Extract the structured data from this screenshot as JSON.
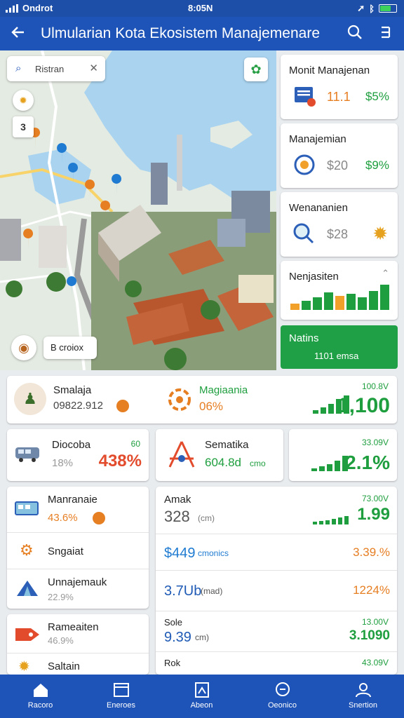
{
  "status": {
    "carrier": "Ondrot",
    "time": "8:05N",
    "battery_level": 0.7
  },
  "appbar": {
    "title": "Ulmularian Kota Ekosistem Manajemenare",
    "back_icon": "arrow-left-icon",
    "search_icon": "search-icon",
    "menu_icon": "menu-icon"
  },
  "map": {
    "search": {
      "value": "Ristran",
      "placeholder": "Search"
    },
    "chip_label": "B croiox",
    "layer_icon": "layers-icon",
    "compass_icon": "compass-icon",
    "location_icon": "location-icon",
    "avatar_icon": "helmet-icon"
  },
  "panel": [
    {
      "title": "Monit Manajenan",
      "value_a": "11.1",
      "value_b": "$5%",
      "icon": "document-icon",
      "value_a_color": "#e67e22"
    },
    {
      "title": "Manajemian",
      "value_a": "$20",
      "value_b": "$9%",
      "icon": "target-icon",
      "value_a_color": "#888888"
    },
    {
      "title": "Wenananien",
      "value_a": "$28",
      "value_b": "",
      "icon": "search-report-icon",
      "value_a_color": "#888888"
    },
    {
      "title": "Nenjasiten",
      "value_a": "",
      "value_b": "",
      "icon": "bar-chart-icon",
      "trend": [
        0.25,
        0.35,
        0.5,
        0.7,
        0.55,
        0.65,
        0.5,
        0.75,
        1.0
      ]
    }
  ],
  "green_card": {
    "title": "Natins",
    "subtitle": "1101 emsa"
  },
  "row1": {
    "user_name": "Smalaja",
    "user_value": "09822.912",
    "mid_title": "Magiaania",
    "mid_value": "06%",
    "right_small": "100.8V",
    "right_big": "1,100",
    "trend": [
      0.2,
      0.35,
      0.55,
      0.8,
      1.0
    ]
  },
  "row2": {
    "left_title": "Diocoba",
    "left_percent": "18%",
    "left_big": "438%",
    "left_small": "60",
    "mid_title": "Sematika",
    "mid_value": "604.8d",
    "mid_unit": "cmo",
    "right_small": "33.09V",
    "right_big": "2.1%",
    "trend": [
      0.2,
      0.3,
      0.45,
      0.7,
      1.0
    ]
  },
  "list_left": [
    {
      "title": "Manranaie",
      "value": "43.6%",
      "icon": "bus-icon"
    },
    {
      "title": "Sngaiat",
      "value": "",
      "icon": "gear-icon"
    },
    {
      "title": "Unnajemauk",
      "value": "22.9%",
      "icon": "tent-icon"
    },
    {
      "title": "Rameaiten",
      "value": "46.9%",
      "icon": "tag-icon"
    },
    {
      "title": "Saltain",
      "value": "",
      "icon": "sun-icon"
    }
  ],
  "list_right": [
    {
      "title": "Amak",
      "value": "328",
      "unit": "(cm)",
      "right_small": "73.00V",
      "right_big": "1.99",
      "value_color": "#555555",
      "right_color": "#1e9e3e"
    },
    {
      "title": "",
      "value": "$449",
      "unit": "cmonics",
      "right_small": "",
      "right_big": "3.39.%",
      "value_color": "#1f7bd1",
      "right_color": "#e67e22"
    },
    {
      "title": "",
      "value": "3.7Ub",
      "unit": "(mad)",
      "right_small": "",
      "right_big": "1224%",
      "value_color": "#1f5ab5",
      "right_color": "#e67e22"
    },
    {
      "title": "Sole",
      "value": "9.39",
      "unit": "cm)",
      "right_small": "13.00V",
      "right_big": "3.1090",
      "value_color": "#1f5ab5",
      "right_color": "#1e9e3e"
    },
    {
      "title": "Rok",
      "value": "",
      "unit": "",
      "right_small": "43.09V",
      "right_big": "",
      "value_color": "#1f5ab5",
      "right_color": "#1e9e3e"
    }
  ],
  "nav": [
    {
      "label": "Racoro",
      "icon": "home-icon"
    },
    {
      "label": "Eneroes",
      "icon": "calendar-icon"
    },
    {
      "label": "Abeon",
      "icon": "clipboard-icon"
    },
    {
      "label": "Oeonico",
      "icon": "search-icon"
    },
    {
      "label": "Snertion",
      "icon": "user-icon"
    }
  ]
}
